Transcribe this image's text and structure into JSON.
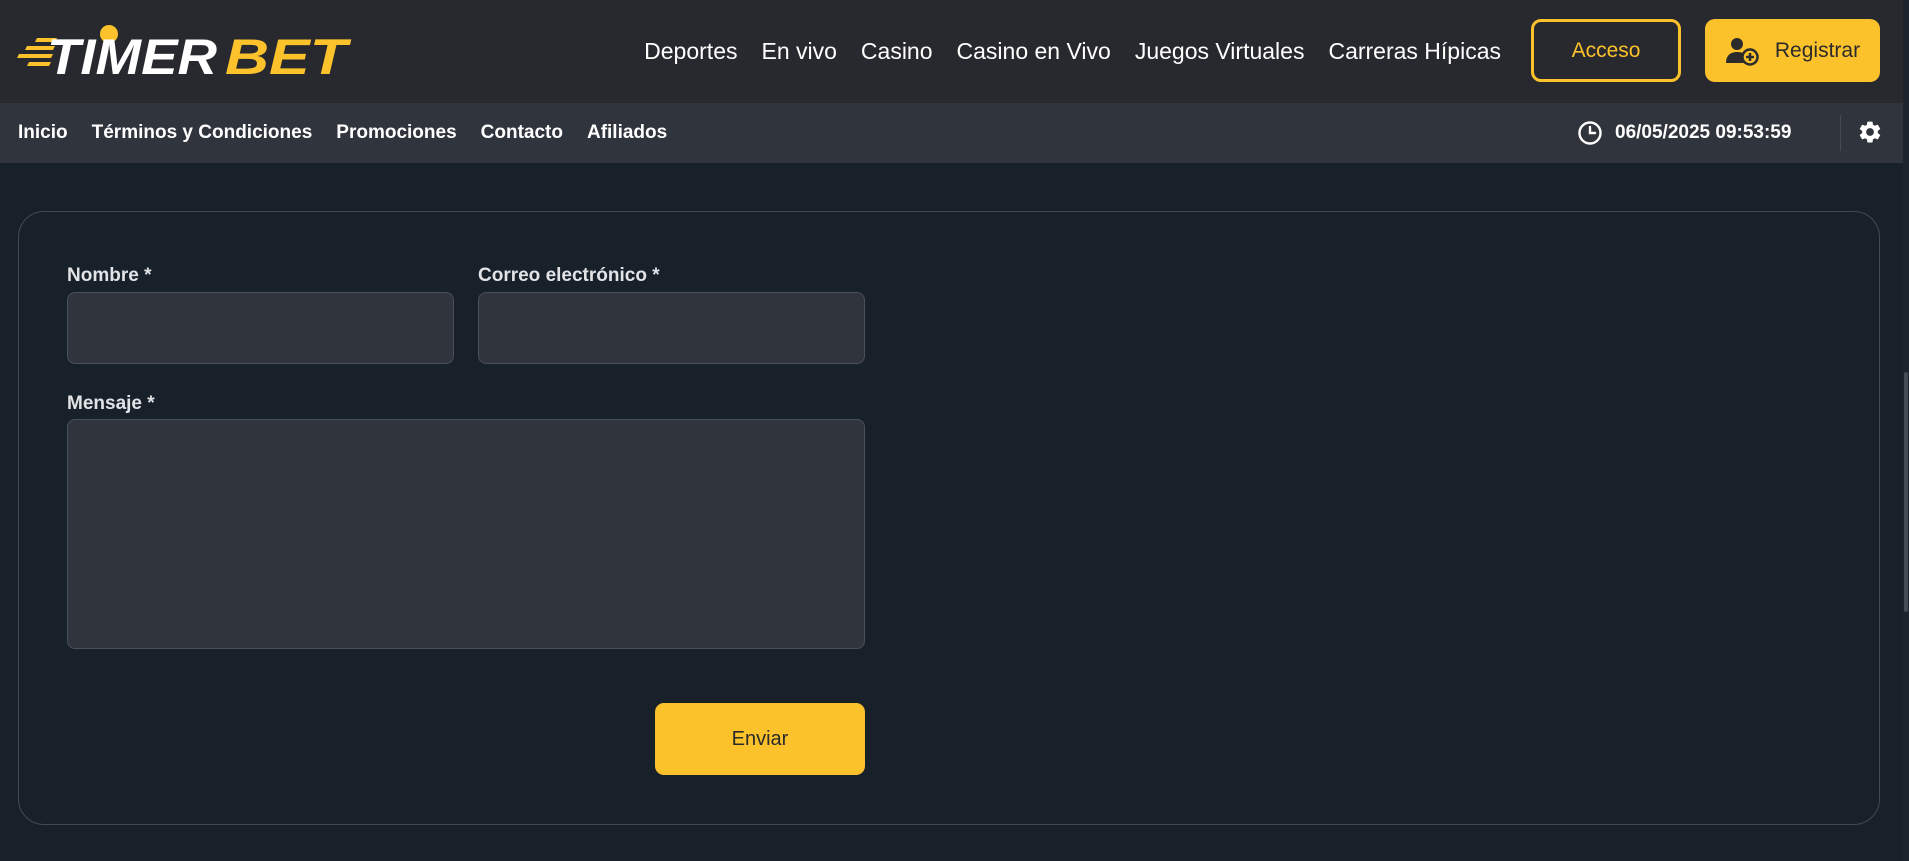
{
  "brand": {
    "logo_text_1": "TIMER",
    "logo_text_2": "BET",
    "accent_color": "#fcc22c",
    "header_bg": "#27292e",
    "subbar_bg": "#30343c",
    "page_bg": "#18202a"
  },
  "header": {
    "nav": [
      {
        "label": "Deportes"
      },
      {
        "label": "En vivo"
      },
      {
        "label": "Casino"
      },
      {
        "label": "Casino en Vivo"
      },
      {
        "label": "Juegos Virtuales"
      },
      {
        "label": "Carreras Hípicas"
      }
    ],
    "login_label": "Acceso",
    "register_label": "Registrar",
    "register_icon": "user-plus-icon"
  },
  "subbar": {
    "links": [
      {
        "label": "Inicio"
      },
      {
        "label": "Términos y Condiciones"
      },
      {
        "label": "Promociones"
      },
      {
        "label": "Contacto"
      },
      {
        "label": "Afiliados"
      }
    ],
    "clock_icon": "clock-icon",
    "datetime": "06/05/2025 09:53:59",
    "settings_icon": "gear-icon"
  },
  "form": {
    "name_label": "Nombre *",
    "name_value": "",
    "email_label": "Correo electrónico *",
    "email_value": "",
    "message_label": "Mensaje *",
    "message_value": "",
    "submit_label": "Enviar"
  }
}
